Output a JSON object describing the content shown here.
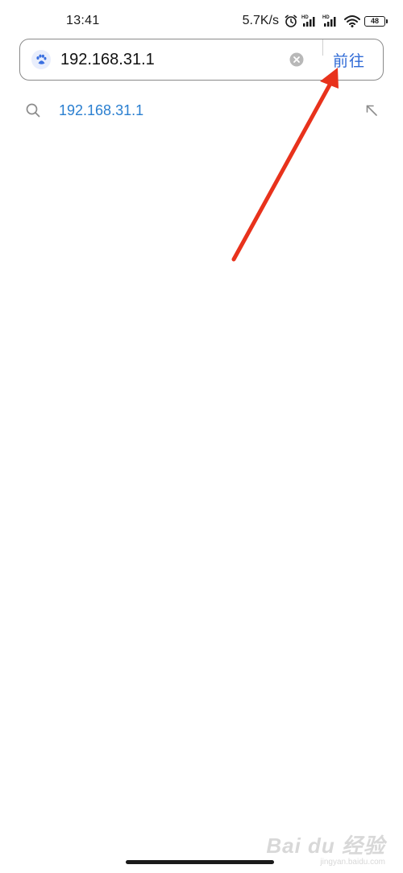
{
  "status_bar": {
    "time": "13:41",
    "net_speed": "5.7K/s",
    "battery_level": "48",
    "icons": [
      "alarm-icon",
      "hd-signal-icon",
      "hd-signal-icon",
      "wifi-icon",
      "battery-icon"
    ]
  },
  "search_bar": {
    "input_value": "192.168.31.1",
    "go_label": "前往",
    "leading_icon": "baidu-paw-icon",
    "clear_icon": "clear-icon"
  },
  "suggestions": [
    {
      "text": "192.168.31.1",
      "icon": "search-icon",
      "action_icon": "fill-query-arrow-icon"
    }
  ],
  "annotation": {
    "arrow_color": "#e8321c"
  },
  "colors": {
    "accent_blue": "#2f6ad6",
    "suggestion_blue": "#2a7fd0"
  },
  "watermark": {
    "main": "Bai du 经验",
    "sub": "jingyan.baidu.com"
  }
}
